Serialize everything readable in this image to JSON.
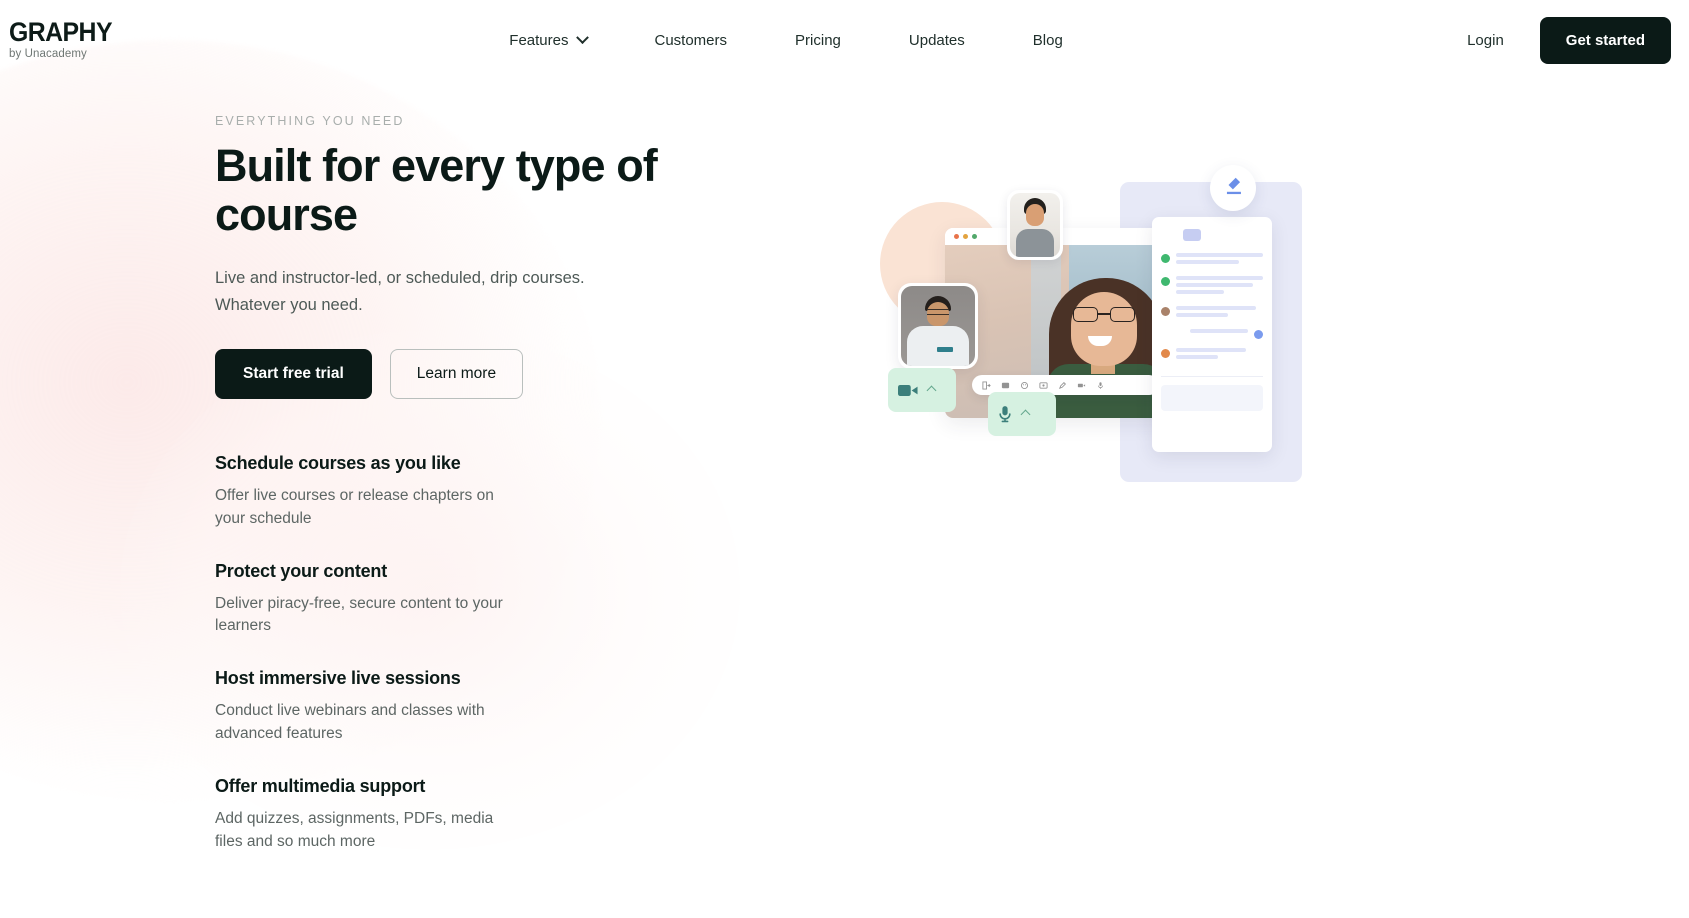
{
  "brand": {
    "logo_word": "GRAPHY",
    "logo_sub": "by Unacademy",
    "accent_dark": "#0b1a17",
    "accent_blue": "#5b86e5",
    "accent_mint": "#d6f1e1",
    "accent_peach": "#fae3d4",
    "accent_lavender": "#e7e9f7"
  },
  "header": {
    "nav": [
      {
        "label": "Features",
        "has_dropdown": true,
        "icon": "chevron-down-icon"
      },
      {
        "label": "Customers",
        "has_dropdown": false
      },
      {
        "label": "Pricing",
        "has_dropdown": false
      },
      {
        "label": "Updates",
        "has_dropdown": false
      },
      {
        "label": "Blog",
        "has_dropdown": false
      }
    ],
    "login_label": "Login",
    "get_started_label": "Get started"
  },
  "hero": {
    "eyebrow": "EVERYTHING YOU NEED",
    "title": "Built for every type of course",
    "subtitle": "Live and instructor-led, or scheduled, drip courses. Whatever you need.",
    "primary_cta": "Start free trial",
    "secondary_cta": "Learn more"
  },
  "features": [
    {
      "title": "Schedule courses as you like",
      "desc": "Offer live courses or release chapters on your schedule"
    },
    {
      "title": "Protect your content",
      "desc": "Deliver piracy-free, secure content to your learners"
    },
    {
      "title": "Host immersive live sessions",
      "desc": "Conduct live webinars and classes with advanced features"
    },
    {
      "title": "Offer multimedia support",
      "desc": "Add quizzes, assignments, PDFs, media files and so much more"
    }
  ],
  "illustration": {
    "alt": "Live video class interface with participants, controls and chat panel",
    "browser_dots": [
      "red",
      "yellow",
      "green"
    ],
    "controls": [
      {
        "icon": "camera-icon",
        "state": "on"
      },
      {
        "icon": "microphone-icon",
        "state": "on"
      }
    ],
    "toolbar_icons": [
      "present-icon",
      "layout-icon",
      "emoji-icon",
      "screen-share-icon",
      "pen-icon",
      "camera-icon",
      "microphone-icon"
    ],
    "chat_avatars": [
      "#3fb86f",
      "#3fb86f",
      "#a9826a",
      "#7b9bee",
      "#e2894a"
    ],
    "edit_badge_icon": "pencil-icon"
  }
}
